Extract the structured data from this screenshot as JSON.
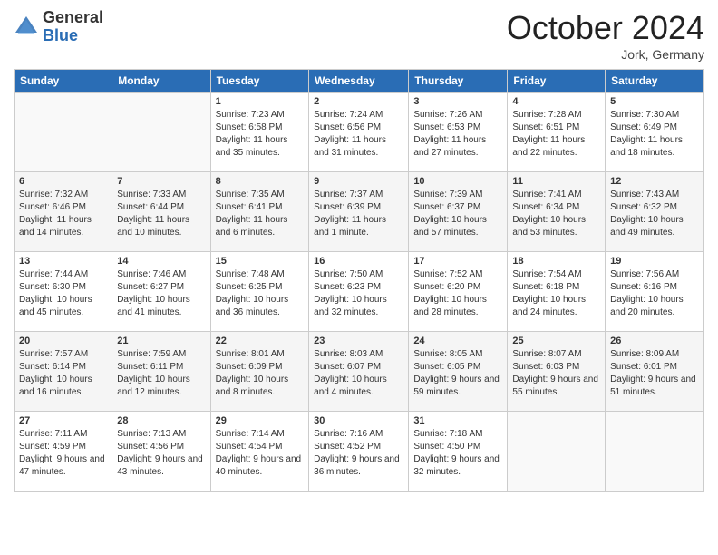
{
  "logo": {
    "general": "General",
    "blue": "Blue"
  },
  "header": {
    "month": "October 2024",
    "location": "Jork, Germany"
  },
  "weekdays": [
    "Sunday",
    "Monday",
    "Tuesday",
    "Wednesday",
    "Thursday",
    "Friday",
    "Saturday"
  ],
  "weeks": [
    [
      {
        "day": "",
        "sunrise": "",
        "sunset": "",
        "daylight": ""
      },
      {
        "day": "",
        "sunrise": "",
        "sunset": "",
        "daylight": ""
      },
      {
        "day": "1",
        "sunrise": "Sunrise: 7:23 AM",
        "sunset": "Sunset: 6:58 PM",
        "daylight": "Daylight: 11 hours and 35 minutes."
      },
      {
        "day": "2",
        "sunrise": "Sunrise: 7:24 AM",
        "sunset": "Sunset: 6:56 PM",
        "daylight": "Daylight: 11 hours and 31 minutes."
      },
      {
        "day": "3",
        "sunrise": "Sunrise: 7:26 AM",
        "sunset": "Sunset: 6:53 PM",
        "daylight": "Daylight: 11 hours and 27 minutes."
      },
      {
        "day": "4",
        "sunrise": "Sunrise: 7:28 AM",
        "sunset": "Sunset: 6:51 PM",
        "daylight": "Daylight: 11 hours and 22 minutes."
      },
      {
        "day": "5",
        "sunrise": "Sunrise: 7:30 AM",
        "sunset": "Sunset: 6:49 PM",
        "daylight": "Daylight: 11 hours and 18 minutes."
      }
    ],
    [
      {
        "day": "6",
        "sunrise": "Sunrise: 7:32 AM",
        "sunset": "Sunset: 6:46 PM",
        "daylight": "Daylight: 11 hours and 14 minutes."
      },
      {
        "day": "7",
        "sunrise": "Sunrise: 7:33 AM",
        "sunset": "Sunset: 6:44 PM",
        "daylight": "Daylight: 11 hours and 10 minutes."
      },
      {
        "day": "8",
        "sunrise": "Sunrise: 7:35 AM",
        "sunset": "Sunset: 6:41 PM",
        "daylight": "Daylight: 11 hours and 6 minutes."
      },
      {
        "day": "9",
        "sunrise": "Sunrise: 7:37 AM",
        "sunset": "Sunset: 6:39 PM",
        "daylight": "Daylight: 11 hours and 1 minute."
      },
      {
        "day": "10",
        "sunrise": "Sunrise: 7:39 AM",
        "sunset": "Sunset: 6:37 PM",
        "daylight": "Daylight: 10 hours and 57 minutes."
      },
      {
        "day": "11",
        "sunrise": "Sunrise: 7:41 AM",
        "sunset": "Sunset: 6:34 PM",
        "daylight": "Daylight: 10 hours and 53 minutes."
      },
      {
        "day": "12",
        "sunrise": "Sunrise: 7:43 AM",
        "sunset": "Sunset: 6:32 PM",
        "daylight": "Daylight: 10 hours and 49 minutes."
      }
    ],
    [
      {
        "day": "13",
        "sunrise": "Sunrise: 7:44 AM",
        "sunset": "Sunset: 6:30 PM",
        "daylight": "Daylight: 10 hours and 45 minutes."
      },
      {
        "day": "14",
        "sunrise": "Sunrise: 7:46 AM",
        "sunset": "Sunset: 6:27 PM",
        "daylight": "Daylight: 10 hours and 41 minutes."
      },
      {
        "day": "15",
        "sunrise": "Sunrise: 7:48 AM",
        "sunset": "Sunset: 6:25 PM",
        "daylight": "Daylight: 10 hours and 36 minutes."
      },
      {
        "day": "16",
        "sunrise": "Sunrise: 7:50 AM",
        "sunset": "Sunset: 6:23 PM",
        "daylight": "Daylight: 10 hours and 32 minutes."
      },
      {
        "day": "17",
        "sunrise": "Sunrise: 7:52 AM",
        "sunset": "Sunset: 6:20 PM",
        "daylight": "Daylight: 10 hours and 28 minutes."
      },
      {
        "day": "18",
        "sunrise": "Sunrise: 7:54 AM",
        "sunset": "Sunset: 6:18 PM",
        "daylight": "Daylight: 10 hours and 24 minutes."
      },
      {
        "day": "19",
        "sunrise": "Sunrise: 7:56 AM",
        "sunset": "Sunset: 6:16 PM",
        "daylight": "Daylight: 10 hours and 20 minutes."
      }
    ],
    [
      {
        "day": "20",
        "sunrise": "Sunrise: 7:57 AM",
        "sunset": "Sunset: 6:14 PM",
        "daylight": "Daylight: 10 hours and 16 minutes."
      },
      {
        "day": "21",
        "sunrise": "Sunrise: 7:59 AM",
        "sunset": "Sunset: 6:11 PM",
        "daylight": "Daylight: 10 hours and 12 minutes."
      },
      {
        "day": "22",
        "sunrise": "Sunrise: 8:01 AM",
        "sunset": "Sunset: 6:09 PM",
        "daylight": "Daylight: 10 hours and 8 minutes."
      },
      {
        "day": "23",
        "sunrise": "Sunrise: 8:03 AM",
        "sunset": "Sunset: 6:07 PM",
        "daylight": "Daylight: 10 hours and 4 minutes."
      },
      {
        "day": "24",
        "sunrise": "Sunrise: 8:05 AM",
        "sunset": "Sunset: 6:05 PM",
        "daylight": "Daylight: 9 hours and 59 minutes."
      },
      {
        "day": "25",
        "sunrise": "Sunrise: 8:07 AM",
        "sunset": "Sunset: 6:03 PM",
        "daylight": "Daylight: 9 hours and 55 minutes."
      },
      {
        "day": "26",
        "sunrise": "Sunrise: 8:09 AM",
        "sunset": "Sunset: 6:01 PM",
        "daylight": "Daylight: 9 hours and 51 minutes."
      }
    ],
    [
      {
        "day": "27",
        "sunrise": "Sunrise: 7:11 AM",
        "sunset": "Sunset: 4:59 PM",
        "daylight": "Daylight: 9 hours and 47 minutes."
      },
      {
        "day": "28",
        "sunrise": "Sunrise: 7:13 AM",
        "sunset": "Sunset: 4:56 PM",
        "daylight": "Daylight: 9 hours and 43 minutes."
      },
      {
        "day": "29",
        "sunrise": "Sunrise: 7:14 AM",
        "sunset": "Sunset: 4:54 PM",
        "daylight": "Daylight: 9 hours and 40 minutes."
      },
      {
        "day": "30",
        "sunrise": "Sunrise: 7:16 AM",
        "sunset": "Sunset: 4:52 PM",
        "daylight": "Daylight: 9 hours and 36 minutes."
      },
      {
        "day": "31",
        "sunrise": "Sunrise: 7:18 AM",
        "sunset": "Sunset: 4:50 PM",
        "daylight": "Daylight: 9 hours and 32 minutes."
      },
      {
        "day": "",
        "sunrise": "",
        "sunset": "",
        "daylight": ""
      },
      {
        "day": "",
        "sunrise": "",
        "sunset": "",
        "daylight": ""
      }
    ]
  ]
}
